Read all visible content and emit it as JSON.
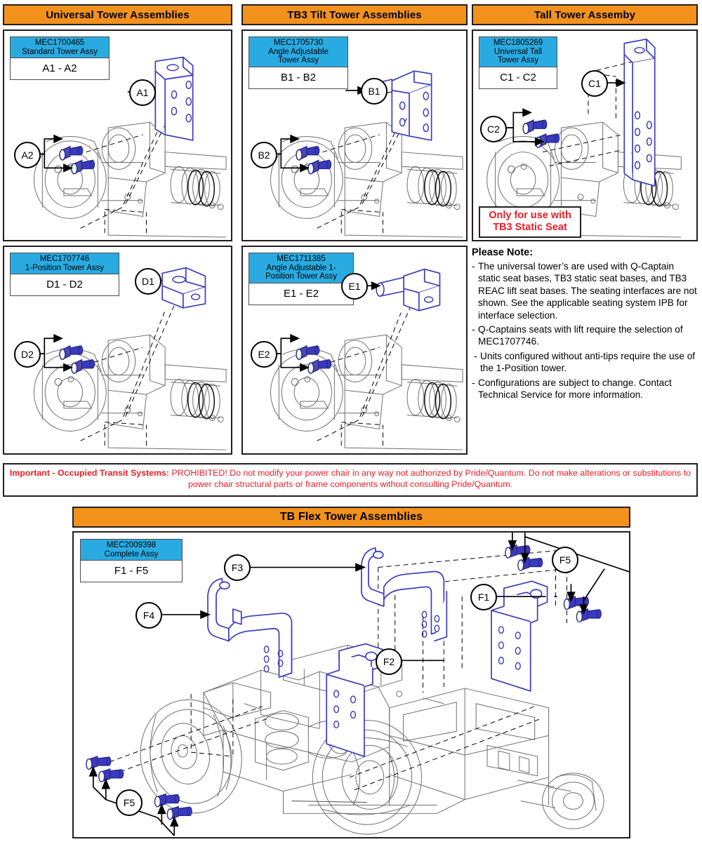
{
  "sections": [
    {
      "id": "universal",
      "title": "Universal Tower Assemblies"
    },
    {
      "id": "tb3tilt",
      "title": "TB3 Tilt Tower Assemblies"
    },
    {
      "id": "tall",
      "title": "Tall Tower Assemby"
    },
    {
      "id": "tbflex",
      "title": "TB Flex Tower Assemblies"
    }
  ],
  "panels": {
    "a": {
      "part_number": "MEC1700465",
      "part_name": "Standard Tower Assy",
      "range": "A1 - A2",
      "callouts": [
        {
          "label": "A1"
        },
        {
          "label": "A2"
        }
      ]
    },
    "b": {
      "part_number": "MEC1705730",
      "part_name": "Angle Adjustable\nTower Assy",
      "range": "B1 - B2",
      "callouts": [
        {
          "label": "B1"
        },
        {
          "label": "B2"
        }
      ]
    },
    "c": {
      "part_number": "MEC1805269",
      "part_name": "Universal Tall\nTower Assy",
      "range": "C1 - C2",
      "callouts": [
        {
          "label": "C1"
        },
        {
          "label": "C2"
        }
      ],
      "warning_line1": "Only for use with",
      "warning_line2": "TB3 Static Seat"
    },
    "d": {
      "part_number": "MEC1707746",
      "part_name": "1-Position Tower Assy",
      "range": "D1 - D2",
      "callouts": [
        {
          "label": "D1"
        },
        {
          "label": "D2"
        }
      ]
    },
    "e": {
      "part_number": "MEC1711385",
      "part_name": "Angle Adjustable 1-\nPosition Tower Assy",
      "range": "E1 - E2",
      "callouts": [
        {
          "label": "E1"
        },
        {
          "label": "E2"
        }
      ]
    },
    "f": {
      "part_number": "MEC2009398",
      "part_name": "Complete Assy",
      "range": "F1 - F5",
      "callouts": [
        {
          "label": "F1"
        },
        {
          "label": "F2"
        },
        {
          "label": "F3"
        },
        {
          "label": "F4"
        },
        {
          "label": "F5"
        },
        {
          "label": "F5"
        }
      ]
    }
  },
  "note": {
    "title": "Please Note:",
    "items": [
      "The universal tower’s are used with Q-Captain static seat bases, TB3 static seat bases, and TB3 REAC lift seat bases. The seating interfaces are not shown. See the applicable seating system IPB for interface selection.",
      "Q-Captains seats with lift require the selection of MEC1707746.",
      "Units configured without anti-tips require the use of the 1-Position tower.",
      "Configurations are subject to change. Contact Technical Service for more information."
    ]
  },
  "transit": {
    "heading": "Important - Occupied Transit Systems:",
    "body": " PROHIBITED! Do not modify your power chair in any way not authorized by Pride/Quantum. Do not make alterations or substitutions to power chair structural parts or frame components without consulting Pride/Quantum."
  },
  "colors": {
    "header_orange": "#F2921D",
    "part_blue": "#29ABE2",
    "highlight_part": "#3a3ac0",
    "warning_red": "#ED1C24",
    "outline": "#231f20"
  }
}
